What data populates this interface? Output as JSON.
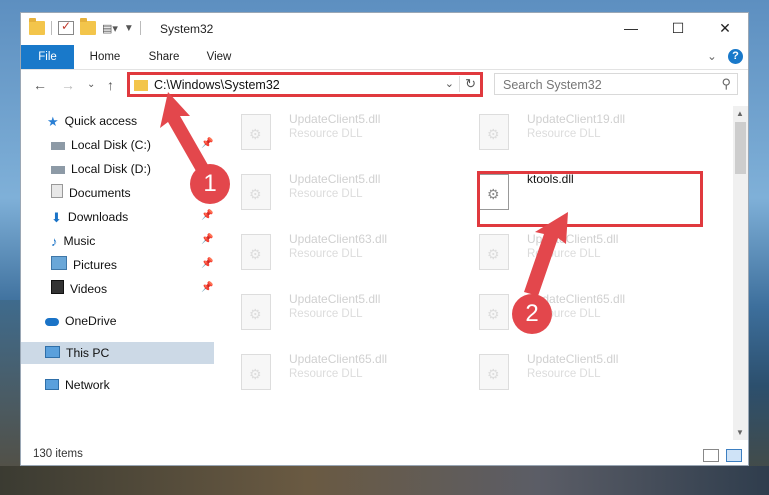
{
  "window": {
    "title": "System32",
    "minimize": "—",
    "maximize": "☐",
    "close": "✕"
  },
  "ribbon": {
    "tabs": [
      "File",
      "Home",
      "Share",
      "View"
    ],
    "expand": "⌄",
    "help": "?"
  },
  "address": {
    "path": "C:\\Windows\\System32",
    "dropdown": "⌄",
    "refresh": "↻",
    "back": "←",
    "forward": "→",
    "recent": "⌄",
    "up": "↑"
  },
  "search": {
    "placeholder": "Search System32",
    "icon": "⚲"
  },
  "nav": {
    "items": [
      {
        "label": "Quick access",
        "icon": "star-icon",
        "pinned": false
      },
      {
        "label": "Local Disk (C:)",
        "icon": "drive-icon",
        "pinned": true
      },
      {
        "label": "Local Disk (D:)",
        "icon": "drive-icon",
        "pinned": false
      },
      {
        "label": "Documents",
        "icon": "documents-icon",
        "pinned": true
      },
      {
        "label": "Downloads",
        "icon": "downloads-icon",
        "pinned": true
      },
      {
        "label": "Music",
        "icon": "music-icon",
        "pinned": true
      },
      {
        "label": "Pictures",
        "icon": "pictures-icon",
        "pinned": true
      },
      {
        "label": "Videos",
        "icon": "videos-icon",
        "pinned": true
      },
      {
        "label": "OneDrive",
        "icon": "onedrive-icon",
        "pinned": false
      },
      {
        "label": "This PC",
        "icon": "pc-icon",
        "pinned": false,
        "selected": true
      },
      {
        "label": "Network",
        "icon": "network-icon",
        "pinned": false
      }
    ],
    "pin_glyph": "📌"
  },
  "files": [
    {
      "name": "UpdateClient5.dll",
      "type": "Resource DLL"
    },
    {
      "name": "UpdateClient19.dll",
      "type": "Resource DLL"
    },
    {
      "name": "UpdateClient5.dll",
      "type": "Resource DLL"
    },
    {
      "name": "ktools.dll",
      "type": ""
    },
    {
      "name": "UpdateClient63.dll",
      "type": "Resource DLL"
    },
    {
      "name": "UpdateClient5.dll",
      "type": "Resource DLL"
    },
    {
      "name": "UpdateClient5.dll",
      "type": "Resource DLL"
    },
    {
      "name": "UpdateClient65.dll",
      "type": "Resource DLL"
    },
    {
      "name": "UpdateClient65.dll",
      "type": "Resource DLL"
    },
    {
      "name": "UpdateClient5.dll",
      "type": "Resource DLL"
    }
  ],
  "status": {
    "items": "130 items"
  },
  "markers": [
    "1",
    "2"
  ],
  "colors": {
    "accent": "#1979ca",
    "highlight": "#e0393e"
  }
}
